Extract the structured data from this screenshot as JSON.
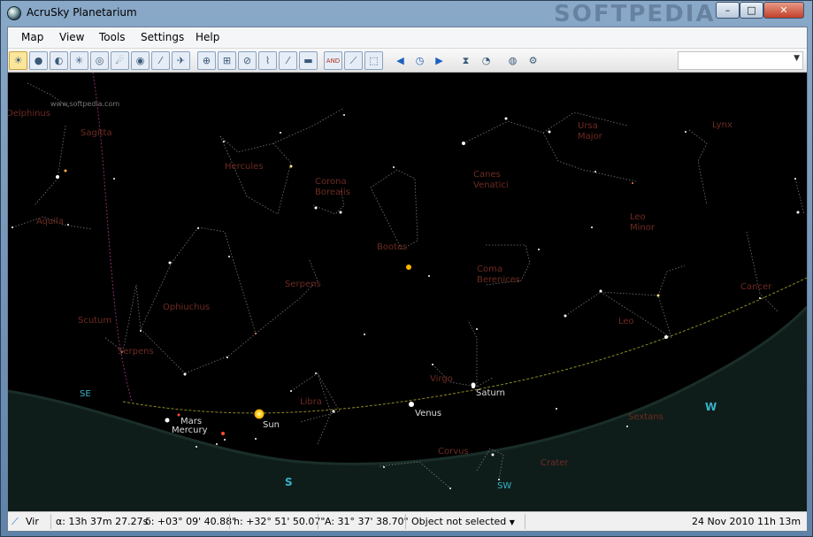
{
  "window": {
    "title": "AcruSky Planetarium",
    "watermark": "SOFTPEDIA",
    "minimize": "–",
    "maximize": "□",
    "close": "✕"
  },
  "menu": [
    "Map",
    "View",
    "Tools",
    "Settings",
    "Help"
  ],
  "toolbar": {
    "icons": [
      {
        "name": "sun-toggle-icon",
        "glyph": "☀"
      },
      {
        "name": "moon-toggle-icon",
        "glyph": "●"
      },
      {
        "name": "planets-toggle-icon",
        "glyph": "◐"
      },
      {
        "name": "stars-toggle-icon",
        "glyph": "✳"
      },
      {
        "name": "deep-sky-toggle-icon",
        "glyph": "◎"
      },
      {
        "name": "comets-toggle-icon",
        "glyph": "☄"
      },
      {
        "name": "asteroids-toggle-icon",
        "glyph": "◉"
      },
      {
        "name": "meteors-toggle-icon",
        "glyph": "⁄"
      },
      {
        "name": "satellites-toggle-icon",
        "glyph": "✈"
      },
      {
        "name": "equatorial-grid-icon",
        "glyph": "⊕"
      },
      {
        "name": "alt-az-grid-icon",
        "glyph": "⊞"
      },
      {
        "name": "ecliptic-icon",
        "glyph": "⊘"
      },
      {
        "name": "milky-way-icon",
        "glyph": "⌇"
      },
      {
        "name": "atmosphere-icon",
        "glyph": "⁄"
      },
      {
        "name": "horizon-icon",
        "glyph": "▬"
      },
      {
        "name": "constellation-names-icon",
        "glyph": "AND"
      },
      {
        "name": "constellation-lines-icon",
        "glyph": "⟋"
      },
      {
        "name": "constellation-boundaries-icon",
        "glyph": "⬚"
      },
      {
        "name": "time-back-icon",
        "glyph": "◀"
      },
      {
        "name": "time-now-icon",
        "glyph": "◷"
      },
      {
        "name": "time-forward-icon",
        "glyph": "▶"
      },
      {
        "name": "time-flow-icon",
        "glyph": "⧗"
      },
      {
        "name": "clock-icon",
        "glyph": "◔"
      },
      {
        "name": "location-globe-icon",
        "glyph": "◍"
      },
      {
        "name": "settings-gears-icon",
        "glyph": "⚙"
      }
    ],
    "search_value": ""
  },
  "sky": {
    "site_watermark": "www.softpedia.com",
    "constellations": [
      "Delphinus",
      "Sagitta",
      "Hercules",
      "Corona",
      "Borealis",
      "Ursa",
      "Major",
      "Lynx",
      "Canes",
      "Venatici",
      "Aquila",
      "Leo",
      "Minor",
      "Bootes",
      "Serpens",
      "Coma",
      "Berenices",
      "Cancer",
      "Ophiuchus",
      "Scutum",
      "Leo",
      "Serpens",
      "Virgo",
      "Libra",
      "Sextans",
      "Corvus",
      "Crater"
    ],
    "planets": [
      "Mars",
      "Mercury",
      "Sun",
      "Venus",
      "Saturn"
    ],
    "compass": [
      "SE",
      "S",
      "SW",
      "W"
    ]
  },
  "status": {
    "constellation": "Vir",
    "ra": "α: 13h 37m 27.27s",
    "dec": "δ: +03° 09' 40.88\"",
    "altitude": "h: +32° 51' 50.07\"",
    "azimuth": "A: 31° 37' 38.70\"",
    "selection": "Object not selected",
    "datetime": "24 Nov 2010 11h 13m"
  }
}
